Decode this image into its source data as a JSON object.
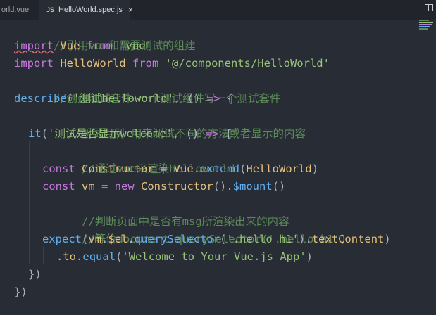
{
  "tabs": [
    {
      "label": "orld.vue",
      "active": false
    },
    {
      "label": "HelloWorld.spec.js",
      "badge": "JS",
      "close": "×",
      "active": true
    }
  ],
  "code": {
    "l1": {
      "comment": "//引用vue和需要测试的组建"
    },
    "l2": {
      "kw": "import",
      "name": " Vue ",
      "from": "from",
      "str": " 'vue'"
    },
    "l3": {
      "kw": "import",
      "name": " HelloWorld ",
      "from": "from",
      "str": " '@/components/HelloWorld'"
    },
    "l4": {
      "comment": "//创建测试套件 一个测试组件写一个测试套件"
    },
    "l5": {
      "fn": "describe",
      "open": "(",
      "str": "'测试helloworld'",
      "rest": ", () ",
      "arrow": "=>",
      "brace": " {"
    },
    "l6": {
      "comment": "//测试用例 用来测试不同的方法或者显示的内容"
    },
    "l7": {
      "fn": "it",
      "open": "(",
      "str": "'测试是否显示welcome'",
      "rest": ", () ",
      "arrow": "=>",
      "brace": " {"
    },
    "l8": {
      "comment": "//通过vue来渲染helloworld"
    },
    "l9": {
      "kw": "const",
      "var": " Constructor ",
      "eq": "=",
      "cls": " Vue",
      "dot": ".",
      "method": "extend",
      "open": "(",
      "arg": "HelloWorld",
      "close": ")"
    },
    "l10": {
      "kw": "const",
      "var": " vm ",
      "eq": "=",
      "new": " new",
      "cls": " Constructor",
      "call": "().",
      "method": "$mount",
      "close": "()"
    },
    "l11": {
      "comment": "//判断页面中是否有msg所渲染出来的内容"
    },
    "l12": {
      "comment": "//等价document.querySelector('.hello h1')"
    },
    "l13": {
      "fn": "expect",
      "open": "(",
      "obj": "vm",
      "dot1": ".",
      "prop1": "$el",
      "dot2": ".",
      "method": "querySelector",
      "open2": "(",
      "str": "'.hello h1'",
      "close2": ").",
      "prop2": "textContent",
      "close": ")"
    },
    "l14": {
      "dot1": ".",
      "prop1": "to",
      "dot2": ".",
      "method": "equal",
      "open": "(",
      "str": "'Welcome to Your Vue.js App'",
      "close": ")"
    },
    "l15": {
      "text": "})"
    },
    "l16": {
      "text": "})"
    }
  },
  "colors": {
    "background": "#282c34",
    "keyword": "#c678dd",
    "string": "#98c379",
    "function": "#61afef",
    "class": "#e5c07b",
    "comment": "#5c8a58",
    "property": "#e06c75"
  }
}
